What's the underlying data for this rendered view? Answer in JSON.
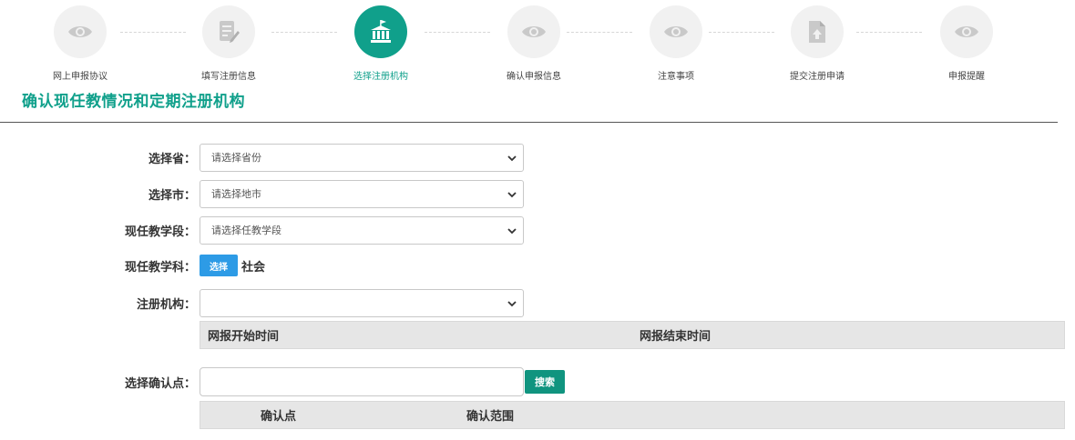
{
  "stepper": {
    "steps": [
      {
        "label": "网上申报协议",
        "icon": "eye-icon"
      },
      {
        "label": "填写注册信息",
        "icon": "edit-document-icon"
      },
      {
        "label": "选择注册机构",
        "icon": "institution-building-icon",
        "active": true
      },
      {
        "label": "确认申报信息",
        "icon": "eye-icon"
      },
      {
        "label": "注意事项",
        "icon": "eye-icon"
      },
      {
        "label": "提交注册申请",
        "icon": "upload-file-icon"
      },
      {
        "label": "申报提醒",
        "icon": "eye-icon"
      }
    ]
  },
  "page_title": "确认现任教情况和定期注册机构",
  "form": {
    "province": {
      "label": "选择省：",
      "value": "请选择省份"
    },
    "city": {
      "label": "选择市：",
      "value": "请选择地市"
    },
    "stage": {
      "label": "现任教学段：",
      "value": "请选择任教学段"
    },
    "subject": {
      "label": "现任教学科：",
      "button": "选择",
      "value": "社会"
    },
    "institution": {
      "label": "注册机构：",
      "value": ""
    },
    "period_table": {
      "headers": [
        "网报开始时间",
        "网报结束时间"
      ]
    },
    "confirm_point": {
      "label": "选择确认点：",
      "placeholder": "",
      "search_button": "搜索"
    },
    "confirm_table": {
      "headers": [
        "",
        "确认点",
        "确认范围"
      ]
    }
  },
  "colors": {
    "accent": "#10a08b",
    "button_blue": "#2d9be6",
    "search_green": "#10947f"
  }
}
